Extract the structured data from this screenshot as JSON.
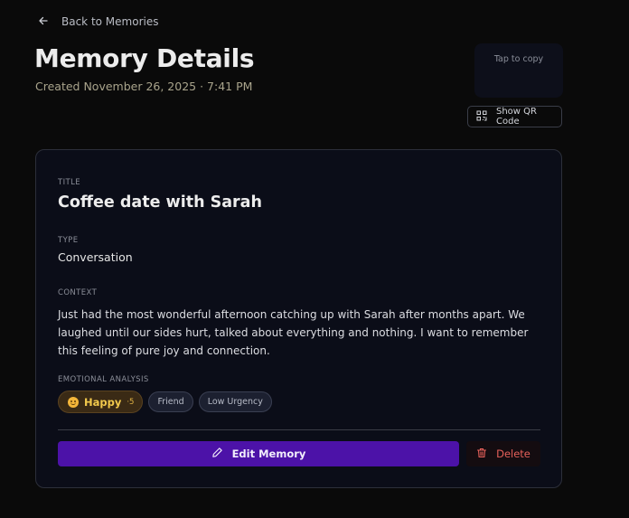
{
  "nav": {
    "back_label": "Back to Memories"
  },
  "header": {
    "title": "Memory Details",
    "created": "Created November 26, 2025 · 7:41 PM",
    "copy_hint": "Tap to copy",
    "qr_button_label": "Show QR Code"
  },
  "memory": {
    "title_label": "Title",
    "title": "Coffee date with Sarah",
    "type_label": "Type",
    "type": "Conversation",
    "context_label": "Context",
    "context": "Just had the most wonderful afternoon catching up with Sarah after months apart. We laughed until our sides hurt, talked about everything and nothing. I want to remember this feeling of pure joy and connection.",
    "analysis_label": "Emotional Analysis",
    "emotion": {
      "label": "Happy",
      "intensity": "·5",
      "icon": "happy-emoji-icon",
      "color": "#f2c94c"
    },
    "tags": [
      "Friend",
      "Low Urgency"
    ]
  },
  "actions": {
    "edit_label": "Edit Memory",
    "delete_label": "Delete"
  },
  "colors": {
    "background": "#0a0a0a",
    "card": "#0b0d18",
    "accent": "#4c12a8",
    "danger": "#e5605a"
  }
}
